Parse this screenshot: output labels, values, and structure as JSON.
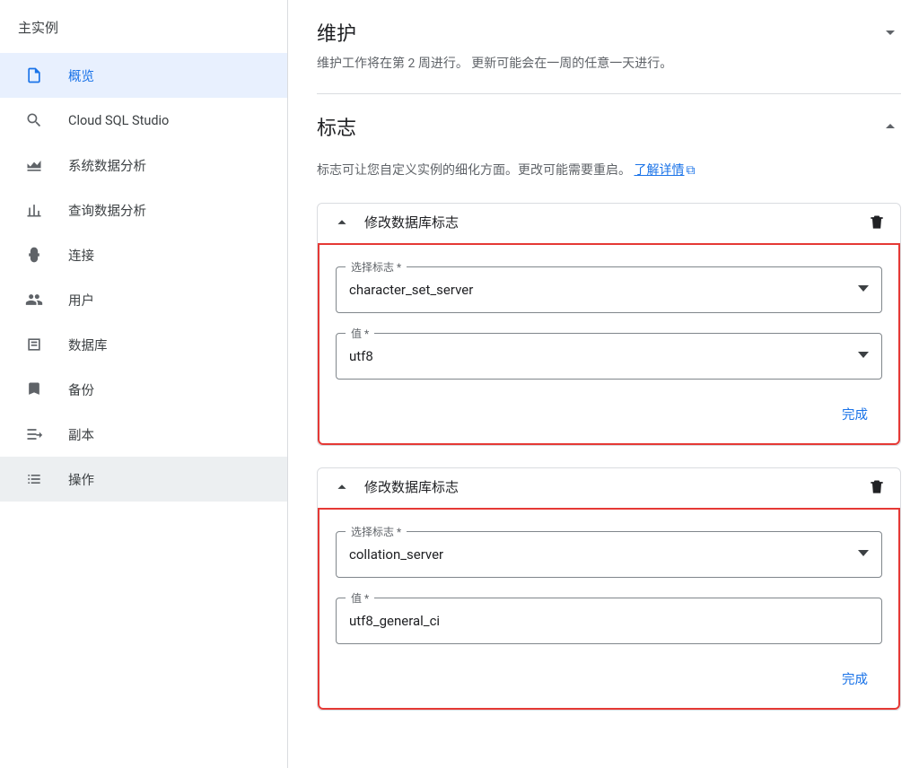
{
  "sidebar": {
    "heading": "主实例",
    "items": [
      {
        "label": "概览",
        "icon": "file",
        "active": true
      },
      {
        "label": "Cloud SQL Studio",
        "icon": "search",
        "active": false
      },
      {
        "label": "系统数据分析",
        "icon": "chart-area",
        "active": false
      },
      {
        "label": "查询数据分析",
        "icon": "chart-bar",
        "active": false
      },
      {
        "label": "连接",
        "icon": "connect",
        "active": false
      },
      {
        "label": "用户",
        "icon": "users",
        "active": false
      },
      {
        "label": "数据库",
        "icon": "database",
        "active": false
      },
      {
        "label": "备份",
        "icon": "backup",
        "active": false
      },
      {
        "label": "副本",
        "icon": "replica",
        "active": false
      },
      {
        "label": "操作",
        "icon": "list",
        "active": false,
        "darkbg": true
      }
    ]
  },
  "maintenance": {
    "title": "维护",
    "desc": "维护工作将在第 2 周进行。 更新可能会在一周的任意一天进行。"
  },
  "flags": {
    "title": "标志",
    "desc_prefix": "标志可让您自定义实例的细化方面。更改可能需要重启。",
    "learn_more": "了解详情",
    "card_title": "修改数据库标志",
    "select_label": "选择标志 *",
    "value_label": "值 *",
    "done": "完成",
    "cards": [
      {
        "select_value": "character_set_server",
        "value_value": "utf8",
        "value_is_dropdown": true,
        "highlight": true
      },
      {
        "select_value": "collation_server",
        "value_value": "utf8_general_ci",
        "value_is_dropdown": false,
        "highlight": true
      }
    ]
  }
}
